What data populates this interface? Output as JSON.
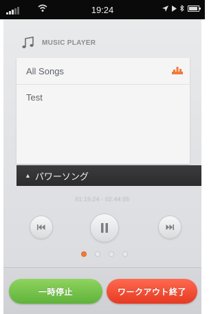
{
  "status_bar": {
    "time": "19:24",
    "signal_icon": "signal-bars-icon",
    "wifi_icon": "wifi-icon",
    "location_icon": "location-arrow-icon",
    "play_icon": "play-indicator-icon",
    "bluetooth_icon": "bluetooth-icon",
    "battery_icon": "battery-icon"
  },
  "header": {
    "icon": "music-note-icon",
    "title": "MUSIC PLAYER"
  },
  "playlist": {
    "items": [
      {
        "label": "All Songs",
        "playing": true
      },
      {
        "label": "Test",
        "playing": false
      }
    ],
    "playing_icon": "equalizer-icon"
  },
  "now_playing": {
    "chevron_icon": "chevron-up-icon",
    "title": "パワーソング",
    "sub_info": "01:15:24  -  02:44:05"
  },
  "controls": {
    "prev_icon": "previous-track-icon",
    "play_pause_icon": "pause-icon",
    "next_icon": "next-track-icon"
  },
  "pager": {
    "count": 4,
    "active_index": 0
  },
  "buttons": {
    "pause_label": "一時停止",
    "end_label": "ワークアウト終了"
  },
  "colors": {
    "accent": "#f07a3c",
    "pause_button": "#6fc046",
    "end_button": "#f0452c"
  }
}
